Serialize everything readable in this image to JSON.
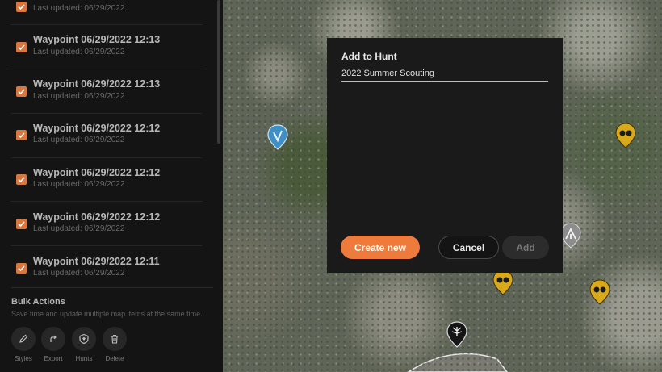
{
  "waypoints": [
    {
      "title": "",
      "subtitle": "Last updated: 06/29/2022"
    },
    {
      "title": "Waypoint 06/29/2022 12:13",
      "subtitle": "Last updated: 06/29/2022"
    },
    {
      "title": "Waypoint 06/29/2022 12:13",
      "subtitle": "Last updated: 06/29/2022"
    },
    {
      "title": "Waypoint 06/29/2022 12:12",
      "subtitle": "Last updated: 06/29/2022"
    },
    {
      "title": "Waypoint 06/29/2022 12:12",
      "subtitle": "Last updated: 06/29/2022"
    },
    {
      "title": "Waypoint 06/29/2022 12:12",
      "subtitle": "Last updated: 06/29/2022"
    },
    {
      "title": "Waypoint 06/29/2022 12:11",
      "subtitle": "Last updated: 06/29/2022"
    }
  ],
  "bulk": {
    "title": "Bulk Actions",
    "description": "Save time and update multiple map items at the same time.",
    "actions": [
      {
        "label": "Styles",
        "icon": "pencil-icon"
      },
      {
        "label": "Export",
        "icon": "export-icon"
      },
      {
        "label": "Hunts",
        "icon": "shield-icon"
      },
      {
        "label": "Delete",
        "icon": "trash-icon"
      }
    ]
  },
  "modal": {
    "title": "Add to Hunt",
    "input_value": "2022 Summer Scouting",
    "create_label": "Create new",
    "cancel_label": "Cancel",
    "add_label": "Add"
  },
  "colors": {
    "accent": "#ee7a3c",
    "checkbox": "#d8783e",
    "pin_yellow": "#d9a91c",
    "pin_blue": "#3f8fc4"
  }
}
